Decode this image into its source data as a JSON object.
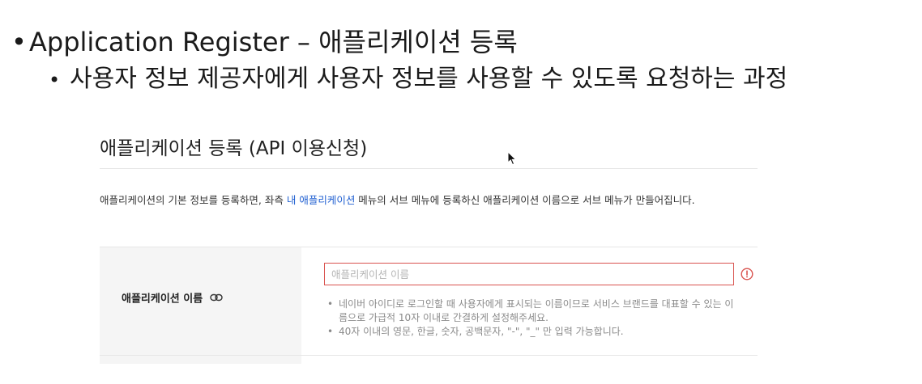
{
  "slide": {
    "bullet1": "Application Register – 애플리케이션 등록",
    "bullet2": "사용자 정보 제공자에게 사용자 정보를 사용할 수 있도록 요청하는 과정"
  },
  "panel": {
    "title": "애플리케이션 등록 (API 이용신청)",
    "description_before": "애플리케이션의 기본 정보를 등록하면, 좌측 ",
    "description_link": "내 애플리케이션",
    "description_after": " 메뉴의 서브 메뉴에 등록하신 애플리케이션 이름으로 서브 메뉴가 만들어집니다."
  },
  "form": {
    "app_name_label": "애플리케이션 이름",
    "app_name_placeholder": "애플리케이션 이름",
    "app_name_value": "",
    "hints": [
      "네이버 아이디로 로그인할 때 사용자에게 표시되는 이름이므로 서비스 브랜드를 대표할 수 있는 이름으로 가급적 10자 이내로 간결하게 설정해주세요.",
      "40자 이내의 영문, 한글, 숫자, 공백문자, \"-\", \"_\" 만 입력 가능합니다."
    ]
  },
  "icons": {
    "label_icon": "link-icon",
    "input_status_icon": "error-icon",
    "pointer": "cursor-icon"
  },
  "colors": {
    "link": "#1f5fd1",
    "error": "#d9534f",
    "label_background": "#f5f5f5"
  }
}
